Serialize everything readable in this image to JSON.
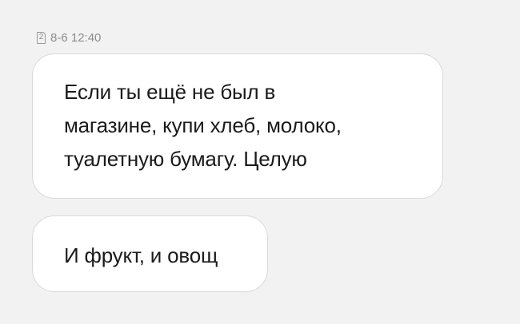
{
  "message_header": {
    "sim_slot": "2",
    "timestamp": "8-6 12:40"
  },
  "messages": [
    {
      "lines": [
        "Если ты ещё не был в",
        "магазине, купи хлеб, молоко,",
        "туалетную бумагу. Целую"
      ]
    },
    {
      "lines": [
        "И фрукт, и овощ"
      ]
    }
  ]
}
